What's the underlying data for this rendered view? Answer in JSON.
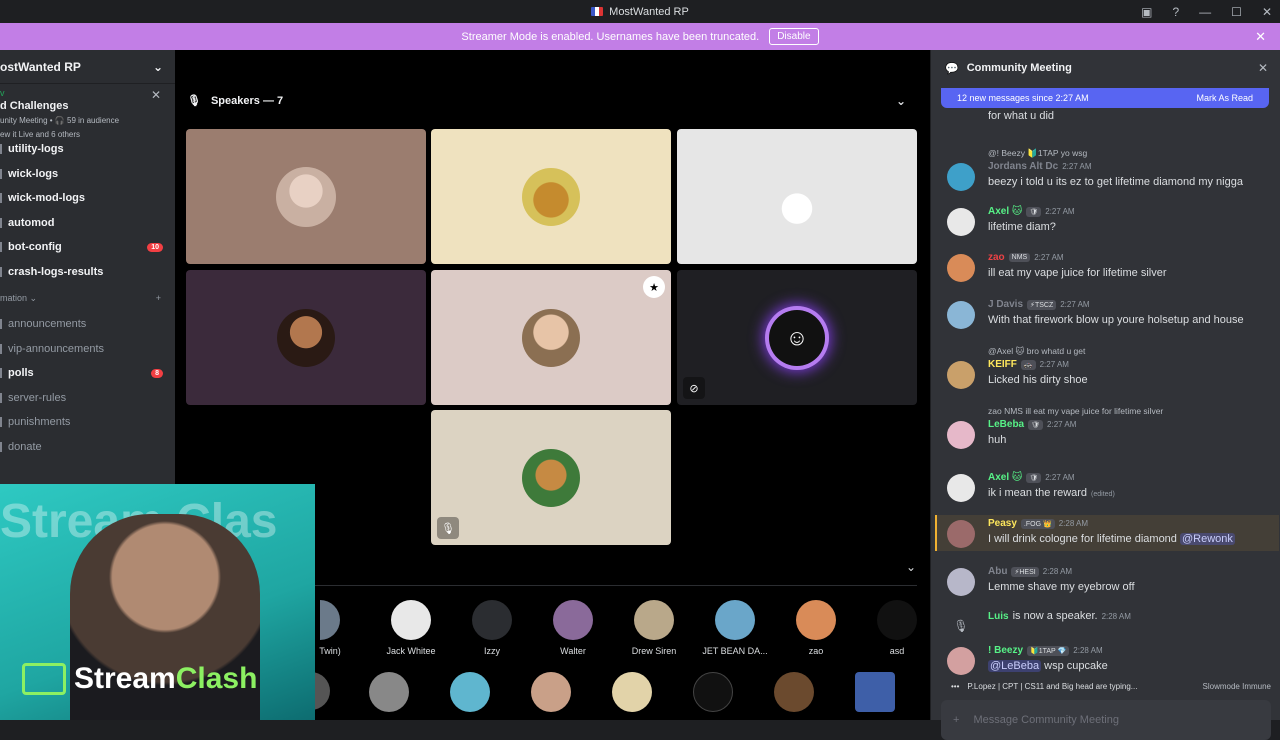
{
  "window": {
    "title": "MostWanted RP"
  },
  "banner": {
    "text": "Streamer Mode is enabled. Usernames have been truncated.",
    "button": "Disable"
  },
  "sidebar": {
    "server_name": "ostWanted RP",
    "event": {
      "tag": "v",
      "title": "d Challenges",
      "sub": "unity Meeting • 🎧 59 in audience",
      "sub2": "ew it Live and 6 others"
    },
    "channels_top": [
      {
        "label": "utility-logs",
        "bold": true
      },
      {
        "label": "wick-logs",
        "bold": true
      },
      {
        "label": "wick-mod-logs",
        "bold": true
      },
      {
        "label": "automod",
        "bold": true
      },
      {
        "label": "bot-config",
        "bold": true,
        "badge": "10"
      },
      {
        "label": "crash-logs-results",
        "bold": true
      }
    ],
    "category": "mation",
    "channels_bottom": [
      {
        "label": "announcements",
        "bold": false
      },
      {
        "label": "vip-announcements",
        "bold": false
      },
      {
        "label": "polls",
        "bold": true,
        "badge": "8"
      },
      {
        "label": "server-rules",
        "bold": false
      },
      {
        "label": "punishments",
        "bold": false
      },
      {
        "label": "donate",
        "bold": false
      }
    ]
  },
  "stage": {
    "speakers_label": "Speakers — 7",
    "audience": [
      {
        "name": "Twin)",
        "color": "#6b7a8a"
      },
      {
        "name": "Jack Whitee",
        "color": "#e8e8e8"
      },
      {
        "name": "Izzy",
        "color": "#2b2d31"
      },
      {
        "name": "Walter",
        "color": "#8a6a9a"
      },
      {
        "name": "Drew Siren",
        "color": "#b9a88a"
      },
      {
        "name": "JET BEAN DA...",
        "color": "#6aa6c9"
      },
      {
        "name": "zao",
        "color": "#d98b58"
      },
      {
        "name": "asd",
        "color": "#111111"
      }
    ]
  },
  "webcam": {
    "brand_a": "Stream",
    "brand_b": "Clash",
    "bg_text": "Stream Clas"
  },
  "chat": {
    "title": "Community Meeting",
    "new_bar": "12 new messages since 2:27 AM",
    "mark_read": "Mark As Read",
    "messages": [
      {
        "reply": "",
        "name": "",
        "tag": "",
        "time": "",
        "body": "for what u did",
        "color": "#dbdee1"
      },
      {
        "reply": "@! Beezy 🔰1TAP yo wsg",
        "name": "Jordans Alt Dc",
        "tag": "",
        "time": "2:27 AM",
        "body": "beezy i told u its ez to get lifetime diamond my nigga",
        "color": "#80848e"
      },
      {
        "reply": "",
        "name": "Axel 🐱",
        "tag": "🛡",
        "time": "2:27 AM",
        "body": "lifetime diam?",
        "color": "#57f287"
      },
      {
        "reply": "",
        "name": "zao",
        "tag": "NMS",
        "time": "2:27 AM",
        "body": "ill eat my vape juice for lifetime silver",
        "color": "#ed4245"
      },
      {
        "reply": "",
        "name": "J Davis",
        "tag": "⚡TSCZ",
        "time": "2:27 AM",
        "body": "With that firework blow up youre holsetup and house",
        "color": "#80848e"
      },
      {
        "reply": "@Axel 🐱 bro whatd u get",
        "name": "KEIFF",
        "tag": "🚓",
        "time": "2:27 AM",
        "body": "Licked his dirty shoe",
        "color": "#fee75c"
      },
      {
        "reply": "zao NMS ill eat my vape juice for lifetime silver",
        "name": "LeBeba",
        "tag": "🛡",
        "time": "2:27 AM",
        "body": "huh",
        "color": "#57f287"
      },
      {
        "reply": "",
        "name": "Axel 🐱",
        "tag": "🛡",
        "time": "2:27 AM",
        "body": "ik i mean the reward",
        "edited": "(edited)",
        "color": "#57f287"
      },
      {
        "reply": "",
        "name": "Peasy",
        "tag": ".FOG 👑",
        "time": "2:28 AM",
        "body": "I will drink cologne for lifetime diamond",
        "mention": "@Rewonk",
        "color": "#fee75c"
      },
      {
        "reply": "",
        "name": "Abu",
        "tag": "⚡HESI",
        "time": "2:28 AM",
        "body": "Lemme shave my eyebrow off",
        "color": "#80848e"
      },
      {
        "reply": "",
        "name": "Luis",
        "tag": "",
        "time": "2:28 AM",
        "body": "is now a speaker.",
        "color": "#57f287"
      },
      {
        "reply": "",
        "name": "! Beezy",
        "tag": "🔰1TAP 💎",
        "time": "2:28 AM",
        "body": "wsp cupcake",
        "mention": "@LeBeba",
        "color": "#57f287"
      }
    ],
    "typing": "P.Lopez | CPT | CS11 and Big head are typing...",
    "slowmode": "Slowmode Immune",
    "composer_placeholder": "Message Community Meeting"
  }
}
